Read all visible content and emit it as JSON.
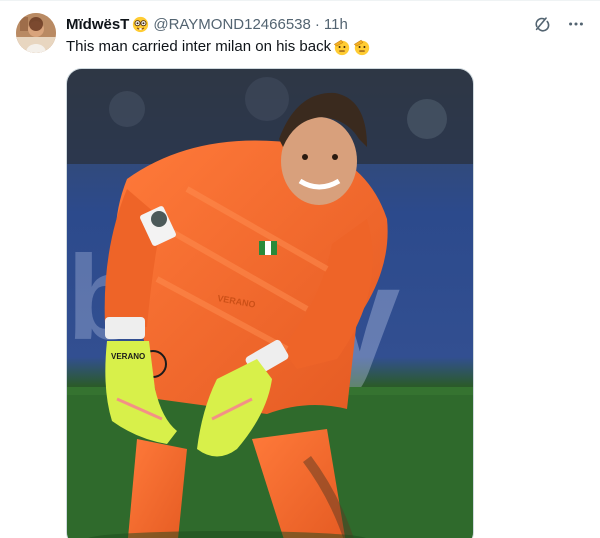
{
  "tweet": {
    "display_name": "MïdwësT",
    "handle": "@RAYMOND12466538",
    "separator": "·",
    "time": "11h",
    "text": "This man carried inter milan on his back",
    "name_emoji": "nerd-face-emoji",
    "text_emojis": [
      "saluting-face-emoji",
      "saluting-face-emoji"
    ],
    "media": {
      "kit_sponsor_text": "VERANO",
      "glove_text": "VERANO"
    }
  },
  "actions": {
    "grok_icon": "grok-icon",
    "more_icon": "more-icon"
  },
  "colors": {
    "text_primary": "#0f1419",
    "text_secondary": "#536471",
    "kit_orange": "#f26a2e",
    "glove_yellow": "#d8f04a",
    "pitch_green": "#2f6a2c"
  }
}
